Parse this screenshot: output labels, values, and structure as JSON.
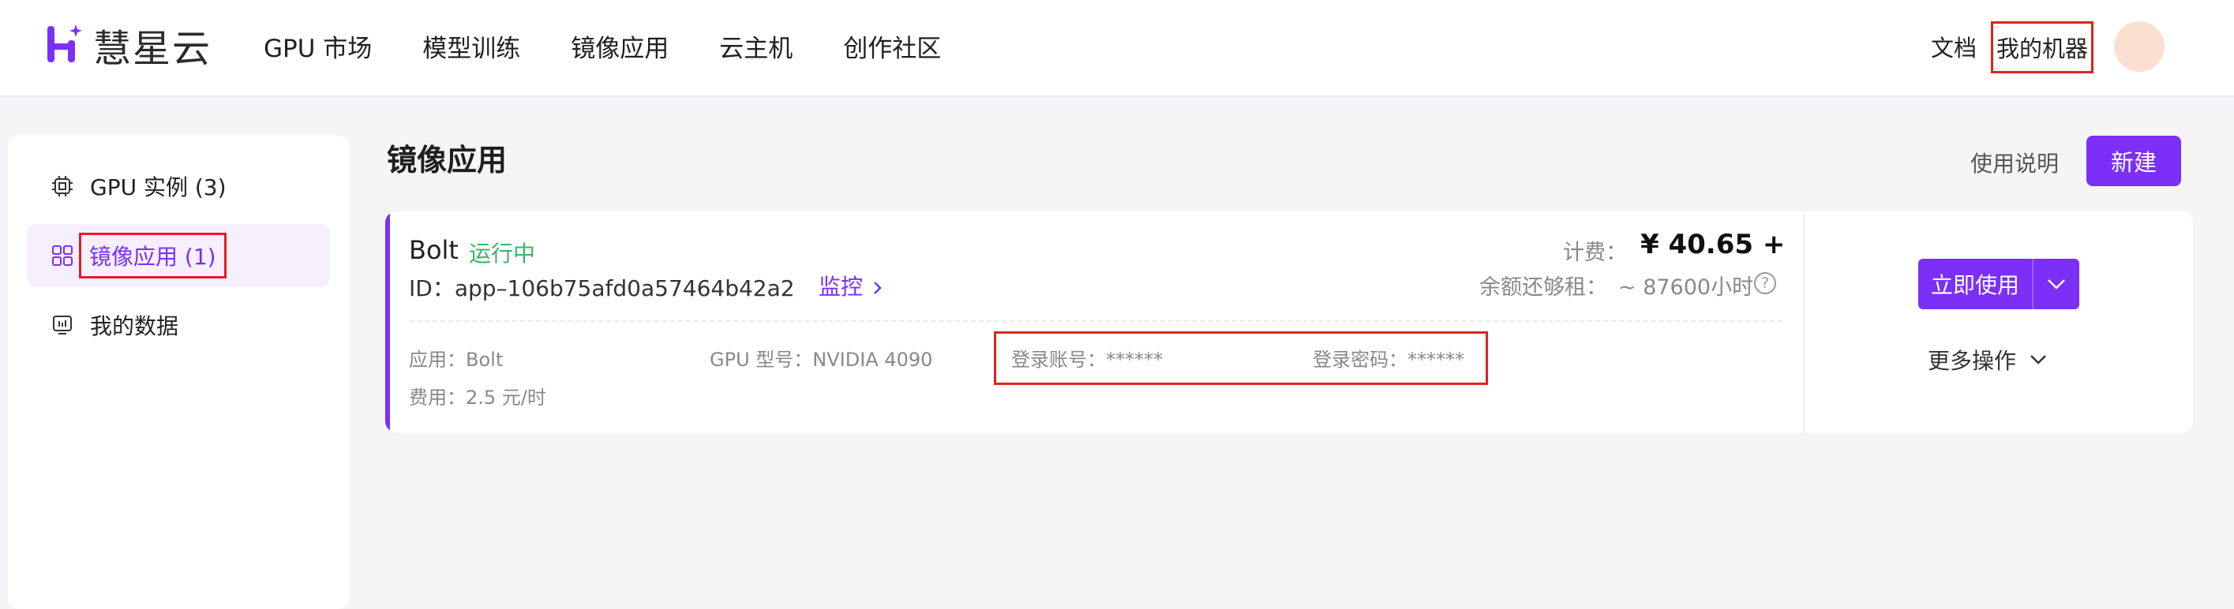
{
  "header": {
    "logo_text": "慧星云",
    "nav": [
      {
        "label": "GPU 市场"
      },
      {
        "label": "模型训练"
      },
      {
        "label": "镜像应用"
      },
      {
        "label": "云主机"
      },
      {
        "label": "创作社区"
      }
    ],
    "docs_label": "文档",
    "my_machines_label": "我的机器",
    "accent_color": "#7b2ff7"
  },
  "sidebar": {
    "items": [
      {
        "label": "GPU 实例 (3)",
        "icon": "chip-icon"
      },
      {
        "label": "镜像应用 (1)",
        "icon": "grid-icon",
        "active": true
      },
      {
        "label": "我的数据",
        "icon": "monitor-icon"
      }
    ]
  },
  "main": {
    "title": "镜像应用",
    "usage_label": "使用说明",
    "new_label": "新建",
    "card": {
      "app_name": "Bolt",
      "status": "运行中",
      "id_text": "ID：app–106b75afd0a57464b42a2",
      "monitor_label": "监控",
      "billing_label": "计费：",
      "billing_value": "¥ 40.65 +",
      "balance_label": "余额还够租：",
      "balance_value": "~ 87600小时",
      "details": {
        "app": "应用：Bolt",
        "gpu": "GPU 型号：NVIDIA 4090",
        "account": "登录账号：******",
        "password": "登录密码：******",
        "fee": "费用：2.5 元/时"
      },
      "use_now_label": "立即使用",
      "more_ops_label": "更多操作"
    }
  }
}
